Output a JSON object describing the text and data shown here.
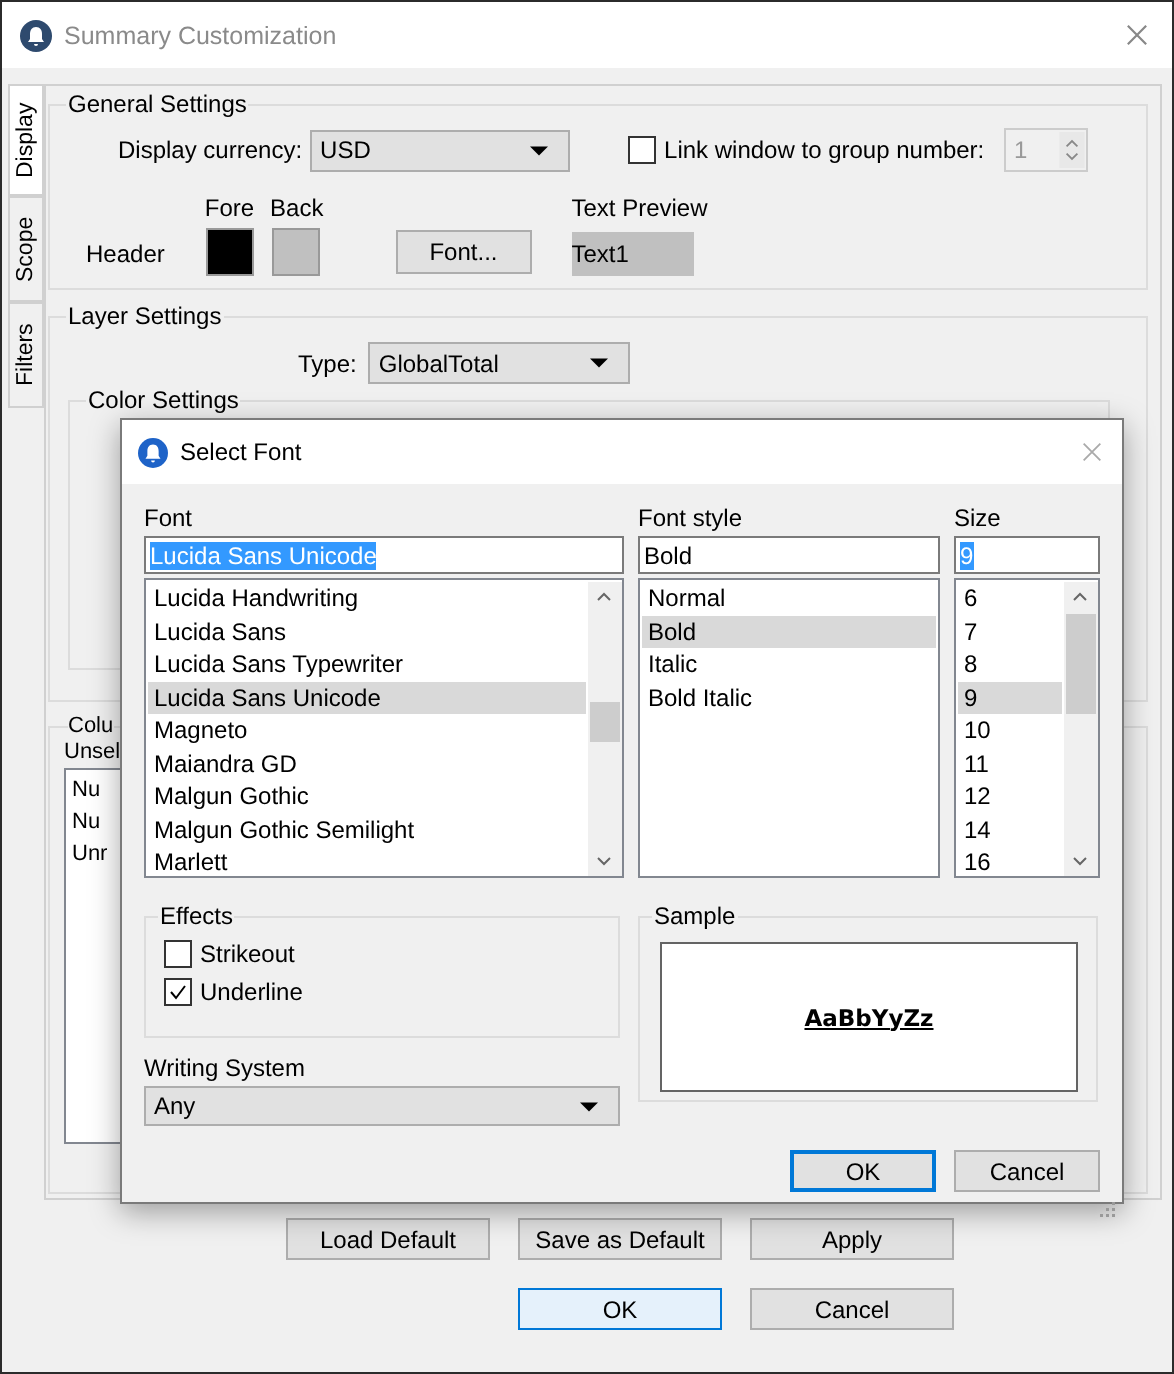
{
  "window": {
    "title": "Summary Customization"
  },
  "side_tabs": [
    {
      "label": "Display",
      "selected": true
    },
    {
      "label": "Scope",
      "selected": false
    },
    {
      "label": "Filters",
      "selected": false
    }
  ],
  "general_settings": {
    "title": "General Settings",
    "currency_label": "Display currency:",
    "currency": "USD",
    "link_label": "Link window to group number:",
    "link_checked": false,
    "group_number": "1",
    "header_label": "Header",
    "fore_label": "Fore",
    "back_label": "Back",
    "swatches": [
      {
        "color": "#000000"
      },
      {
        "color": "#c0c0c0"
      }
    ],
    "font_button": "Font...",
    "preview_label": "Text Preview",
    "preview_text": "Text1"
  },
  "layer_settings": {
    "title": "Layer Settings",
    "type_label": "Type:",
    "type": "GlobalTotal",
    "color_settings_title": "Color Settings"
  },
  "columns": {
    "title": "Colu",
    "list_label": "Unsel",
    "items": [
      "Nu",
      "Nu",
      "Unr"
    ]
  },
  "buttons": [
    "Load Default",
    "Save as Default",
    "Apply"
  ],
  "footer_buttons": [
    {
      "label": "OK",
      "default": true
    },
    {
      "label": "Cancel",
      "default": false
    }
  ],
  "dialog": {
    "title": "Select Font",
    "font_label": "Font",
    "font_value": "Lucida Sans Unicode",
    "fonts": [
      {
        "label": "Lucida Handwriting",
        "selected": false
      },
      {
        "label": "Lucida Sans",
        "selected": false
      },
      {
        "label": "Lucida Sans Typewriter",
        "selected": false
      },
      {
        "label": "Lucida Sans Unicode",
        "selected": true
      },
      {
        "label": "Magneto",
        "selected": false
      },
      {
        "label": "Maiandra GD",
        "selected": false
      },
      {
        "label": "Malgun Gothic",
        "selected": false
      },
      {
        "label": "Malgun Gothic Semilight",
        "selected": false
      },
      {
        "label": "Marlett",
        "selected": false
      }
    ],
    "style_label": "Font style",
    "style_value": "Bold",
    "styles": [
      {
        "label": "Normal",
        "selected": false
      },
      {
        "label": "Bold",
        "selected": true
      },
      {
        "label": "Italic",
        "selected": false
      },
      {
        "label": "Bold Italic",
        "selected": false
      }
    ],
    "size_label": "Size",
    "size_value": "9",
    "sizes": [
      {
        "label": "6",
        "selected": false
      },
      {
        "label": "7",
        "selected": false
      },
      {
        "label": "8",
        "selected": false
      },
      {
        "label": "9",
        "selected": true
      },
      {
        "label": "10",
        "selected": false
      },
      {
        "label": "11",
        "selected": false
      },
      {
        "label": "12",
        "selected": false
      },
      {
        "label": "14",
        "selected": false
      },
      {
        "label": "16",
        "selected": false
      }
    ],
    "effects_title": "Effects",
    "effects": [
      {
        "label": "Strikeout",
        "checked": false
      },
      {
        "label": "Underline",
        "checked": true
      }
    ],
    "writing_system_label": "Writing System",
    "writing_system": "Any",
    "sample_title": "Sample",
    "sample_text": "AaBbYyZz",
    "buttons": [
      {
        "label": "OK",
        "default": true
      },
      {
        "label": "Cancel",
        "default": false
      }
    ]
  }
}
